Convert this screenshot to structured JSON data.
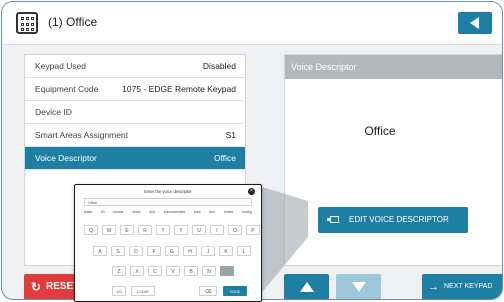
{
  "header": {
    "title": "(1) Office"
  },
  "details": {
    "rows": [
      {
        "label": "Keypad Used",
        "value": "Disabled"
      },
      {
        "label": "Equipment Code",
        "value": "1075 - EDGE Remote Keypad"
      },
      {
        "label": "Device ID",
        "value": ""
      },
      {
        "label": "Smart Areas Assignment",
        "value": "S1"
      },
      {
        "label": "Voice Descriptor",
        "value": "Office"
      }
    ]
  },
  "descriptor": {
    "heading": "Voice Descriptor",
    "value": "Office",
    "edit_label": "EDIT VOICE DESCRIPTOR"
  },
  "footer": {
    "reset_label": "RESET",
    "next_label": "NEXT KEYPAD"
  },
  "keyboard": {
    "title": "Enter the voice descriptor",
    "input_value": "Office",
    "suggestions": [
      "Alarm",
      "All",
      "Access",
      "Alarm",
      "And",
      "Announcement",
      "Area",
      "Arm",
      "Armed",
      "Arming"
    ],
    "row1": [
      "Q",
      "W",
      "E",
      "R",
      "T",
      "Y",
      "U",
      "I",
      "O",
      "P"
    ],
    "row2": [
      "A",
      "S",
      "D",
      "F",
      "G",
      "H",
      "J",
      "K",
      "L"
    ],
    "row3": [
      "Z",
      "X",
      "C",
      "V",
      "B",
      "N",
      "M"
    ],
    "num_label": "123",
    "clear_label": "CLEAR",
    "done_label": "DONE"
  },
  "colors": {
    "accent": "#1e7fa5",
    "reset": "#e03c3c",
    "panel_header": "#b3b8bd"
  }
}
